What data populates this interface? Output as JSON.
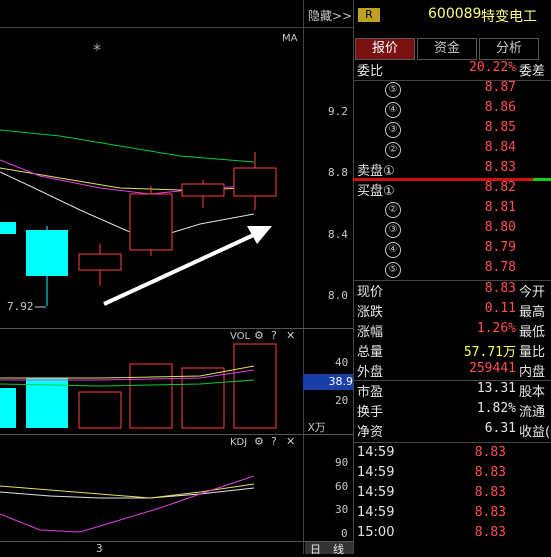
{
  "header": {
    "hide_label": "隐藏>>",
    "r_badge": "R",
    "stock_code": "600089",
    "stock_name": "特变电工"
  },
  "chart": {
    "ma_label": "MA",
    "star_symbol": "*",
    "price_ticks": [
      "9.2",
      "8.8",
      "8.4",
      "8.0"
    ],
    "low_marker": "7.92",
    "vol_label": "VOL",
    "vol_ticks": [
      "40",
      "20"
    ],
    "vol_value": "38.9",
    "vol_unit": "X万",
    "kdj_label": "KDJ",
    "kdj_ticks": [
      "90",
      "60",
      "30",
      "0"
    ],
    "date_label": "3",
    "gear_icon_symbol": "⚙",
    "help_icon_symbol": "?",
    "close_icon_symbol": "✕",
    "bottom_buttons": [
      "日",
      "线"
    ]
  },
  "tabs": [
    {
      "label": "报价",
      "active": true
    },
    {
      "label": "资金",
      "active": false
    },
    {
      "label": "分析",
      "active": false
    }
  ],
  "summary": {
    "weibi_label": "委比",
    "weibi_value": "20.22%",
    "weicha_label": "委差"
  },
  "sell_orders": [
    {
      "num": "⑤",
      "price": "8.87"
    },
    {
      "num": "④",
      "price": "8.86"
    },
    {
      "num": "③",
      "price": "8.85"
    },
    {
      "num": "②",
      "price": "8.84"
    },
    {
      "num": "卖盘①",
      "price": "8.83"
    }
  ],
  "buy_orders": [
    {
      "num": "买盘①",
      "price": "8.82"
    },
    {
      "num": "②",
      "price": "8.81"
    },
    {
      "num": "③",
      "price": "8.80"
    },
    {
      "num": "④",
      "price": "8.79"
    },
    {
      "num": "⑤",
      "price": "8.78"
    }
  ],
  "quote": [
    {
      "label": "现价",
      "value": "8.83",
      "color": "red",
      "right_label": "今开"
    },
    {
      "label": "涨跌",
      "value": "0.11",
      "color": "red",
      "right_label": "最高"
    },
    {
      "label": "涨幅",
      "value": "1.26%",
      "color": "red",
      "right_label": "最低"
    },
    {
      "label": "总量",
      "value": "57.71万",
      "color": "yellow",
      "right_label": "量比"
    },
    {
      "label": "外盘",
      "value": "259441",
      "color": "red",
      "right_label": "内盘"
    },
    {
      "label": "市盈",
      "value": "13.31",
      "color": "white",
      "right_label": "股本"
    },
    {
      "label": "换手",
      "value": "1.82%",
      "color": "white",
      "right_label": "流通"
    },
    {
      "label": "净资",
      "value": "6.31",
      "color": "white",
      "right_label": "收益(三"
    }
  ],
  "ticks": [
    {
      "time": "14:59",
      "price": "8.83"
    },
    {
      "time": "14:59",
      "price": "8.83"
    },
    {
      "time": "14:59",
      "price": "8.83"
    },
    {
      "time": "14:59",
      "price": "8.83"
    },
    {
      "time": "15:00",
      "price": "8.83"
    }
  ]
}
